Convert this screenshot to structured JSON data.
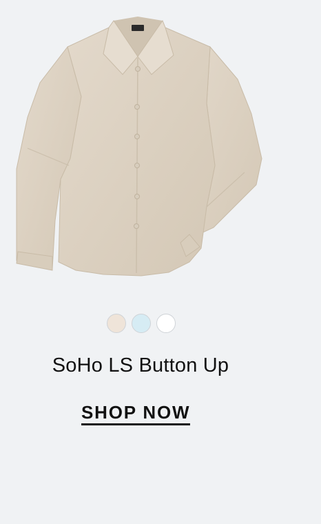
{
  "product": {
    "name": "SoHo LS Button Up",
    "image_icon": "button-up-shirt-image",
    "shirt_color": "#ddd2c2",
    "cta_label": "SHOP NOW"
  },
  "swatches": [
    {
      "name": "beige",
      "color": "#efe4d9"
    },
    {
      "name": "light-blue",
      "color": "#d6ecf4"
    },
    {
      "name": "white",
      "color": "#ffffff"
    }
  ]
}
